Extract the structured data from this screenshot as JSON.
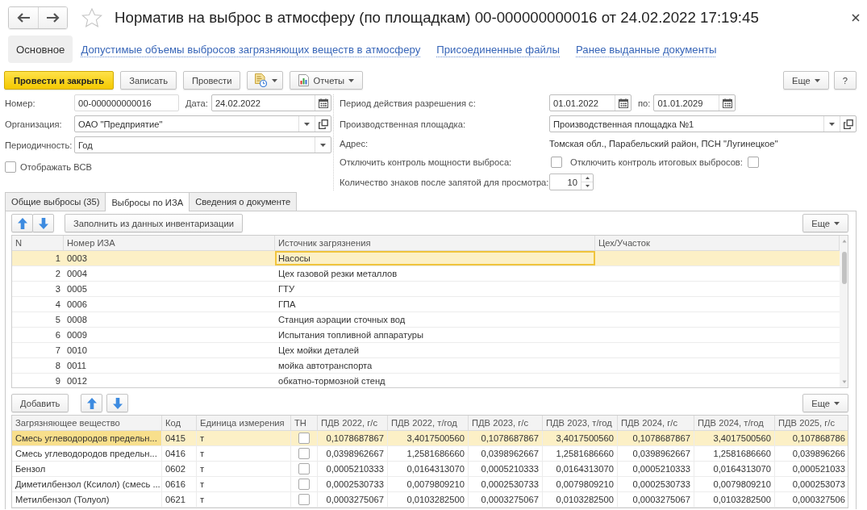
{
  "window": {
    "title": "Норматив на выброс в атмосферу (по площадкам) 00-000000000016 от 24.02.2022 17:19:45"
  },
  "sections": [
    {
      "label": "Основное",
      "selected": true
    },
    {
      "label": "Допустимые объемы выбросов загрязняющих веществ в атмосферу",
      "selected": false
    },
    {
      "label": "Присоединенные файлы",
      "selected": false
    },
    {
      "label": "Ранее выданные документы",
      "selected": false
    }
  ],
  "toolbar": {
    "left": [
      {
        "kind": "primary",
        "label": "Провести и закрыть"
      },
      {
        "kind": "plain",
        "label": "Записать"
      },
      {
        "kind": "plain",
        "label": "Провести"
      },
      {
        "kind": "icon_menu"
      },
      {
        "kind": "icon_label_menu",
        "label": "Отчеты"
      }
    ],
    "right": [
      {
        "kind": "menu",
        "label": "Еще"
      },
      {
        "kind": "plain",
        "label": "?"
      }
    ]
  },
  "form": {
    "number": {
      "label": "Номер:",
      "value": "00-000000000016"
    },
    "date": {
      "label": "Дата:",
      "value": "24.02.2022"
    },
    "organization": {
      "label": "Организация:",
      "value": "ОАО \"Предприятие\""
    },
    "periodicity": {
      "label": "Периодичность:",
      "value": "Год"
    },
    "show_vsv": {
      "label": "Отображать ВСВ",
      "checked": false
    },
    "permit_period": {
      "label": "Период действия разрешения с:",
      "from": "01.01.2022",
      "to_label": "по:",
      "to": "01.01.2029"
    },
    "site": {
      "label": "Производственная площадка:",
      "value": "Производственная площадка №1"
    },
    "address": {
      "label": "Адрес:",
      "value": "Томская обл., Парабельский район, ПСН \"Лугинецкое\""
    },
    "disable_power_control": {
      "label": "Отключить контроль мощности выброса:",
      "checked": false
    },
    "disable_total_control": {
      "label": "Отключить контроль итоговых выбросов:",
      "checked": false
    },
    "decimal_places": {
      "label": "Количество знаков после запятой для просмотра:",
      "value": "10"
    }
  },
  "tabs": [
    {
      "label": "Общие выбросы (35)",
      "selected": false
    },
    {
      "label": "Выбросы по ИЗА",
      "selected": true
    },
    {
      "label": "Сведения о документе",
      "selected": false
    }
  ],
  "sources": {
    "toolbar": {
      "left": [
        {
          "kind": "move_up"
        },
        {
          "kind": "move_down"
        },
        {
          "kind": "plain",
          "label": "Заполнить из данных инвентаризации"
        }
      ],
      "right": [
        {
          "kind": "menu",
          "label": "Еще"
        }
      ]
    },
    "table": {
      "columns": [
        "N",
        "Номер ИЗА",
        "Источник загрязнения",
        "Цех/Участок"
      ],
      "rows": [
        {
          "n": "1",
          "iza": "0003",
          "source": "Насосы",
          "selected": true
        },
        {
          "n": "2",
          "iza": "0004",
          "source": "Цех газовой резки металлов",
          "selected": false
        },
        {
          "n": "3",
          "iza": "0005",
          "source": "ГТУ",
          "selected": false
        },
        {
          "n": "4",
          "iza": "0006",
          "source": "ГПА",
          "selected": false
        },
        {
          "n": "5",
          "iza": "0008",
          "source": "Станция аэрации сточных вод",
          "selected": false
        },
        {
          "n": "6",
          "iza": "0009",
          "source": "Испытания топливной аппаратуры",
          "selected": false
        },
        {
          "n": "7",
          "iza": "0010",
          "source": "Цех мойки деталей",
          "selected": false
        },
        {
          "n": "8",
          "iza": "0011",
          "source": "мойка автотранспорта",
          "selected": false
        },
        {
          "n": "9",
          "iza": "0012",
          "source": "обкатно-тормозной стенд",
          "selected": false
        }
      ]
    }
  },
  "pollutants": {
    "toolbar": {
      "left": [
        {
          "kind": "plain",
          "label": "Добавить"
        },
        {
          "kind": "move_up"
        },
        {
          "kind": "move_down"
        }
      ],
      "right": [
        {
          "kind": "menu",
          "label": "Еще"
        }
      ]
    },
    "table": {
      "columns": [
        "Загрязняющее вещество",
        "Код",
        "Единица измерения",
        "ТН",
        "ПДВ 2022, г/с",
        "ПДВ 2022, т/год",
        "ПДВ 2023, г/с",
        "ПДВ 2023, т/год",
        "ПДВ 2024, г/с",
        "ПДВ 2024, т/год",
        "ПДВ 2025, г/с"
      ],
      "rows": [
        {
          "substance": "Смесь углеводородов предельн...",
          "code": "0415",
          "unit": "т",
          "tn": false,
          "selected": true,
          "values": [
            "0,1078687867",
            "3,4017500560",
            "0,1078687867",
            "3,4017500560",
            "0,1078687867",
            "3,4017500560",
            "0,107868786"
          ]
        },
        {
          "substance": "Смесь углеводородов предельн...",
          "code": "0416",
          "unit": "т",
          "tn": false,
          "selected": false,
          "values": [
            "0,0398962667",
            "1,2581686660",
            "0,0398962667",
            "1,2581686660",
            "0,0398962667",
            "1,2581686660",
            "0,039896266"
          ]
        },
        {
          "substance": "Бензол",
          "code": "0602",
          "unit": "т",
          "tn": false,
          "selected": false,
          "values": [
            "0,0005210333",
            "0,0164313070",
            "0,0005210333",
            "0,0164313070",
            "0,0005210333",
            "0,0164313070",
            "0,000521033"
          ]
        },
        {
          "substance": "Диметилбензол (Ксилол) (смесь ...",
          "code": "0616",
          "unit": "т",
          "tn": false,
          "selected": false,
          "values": [
            "0,0002530733",
            "0,0079809210",
            "0,0002530733",
            "0,0079809210",
            "0,0002530733",
            "0,0079809210",
            "0,000253073"
          ]
        },
        {
          "substance": "Метилбензол (Толуол)",
          "code": "0621",
          "unit": "т",
          "tn": false,
          "selected": false,
          "values": [
            "0,0003275067",
            "0,0103282500",
            "0,0003275067",
            "0,0103282500",
            "0,0003275067",
            "0,0103282500",
            "0,000327506"
          ]
        }
      ]
    }
  }
}
